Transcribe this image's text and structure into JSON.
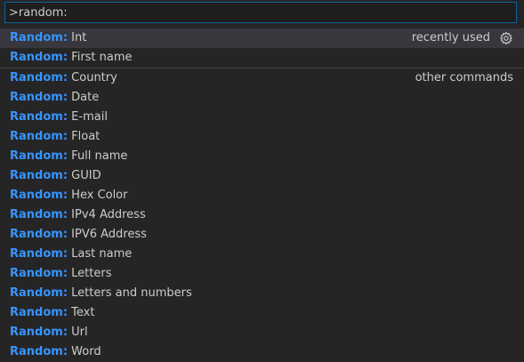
{
  "search": {
    "value": ">random:",
    "placeholder": ""
  },
  "colors": {
    "accent": "#3794ff",
    "focus_border": "#0e639c",
    "selected_bg": "#37373d",
    "panel_bg": "#252526"
  },
  "groups": {
    "recent_label": "recently used",
    "other_label": "other commands",
    "gear_icon": "gear-icon"
  },
  "prefix": "Random:",
  "recent": [
    {
      "name": "Int"
    },
    {
      "name": "First name"
    }
  ],
  "others": [
    {
      "name": "Country"
    },
    {
      "name": "Date"
    },
    {
      "name": "E-mail"
    },
    {
      "name": "Float"
    },
    {
      "name": "Full name"
    },
    {
      "name": "GUID"
    },
    {
      "name": "Hex Color"
    },
    {
      "name": "IPv4 Address"
    },
    {
      "name": "IPV6 Address"
    },
    {
      "name": "Last name"
    },
    {
      "name": "Letters"
    },
    {
      "name": "Letters and numbers"
    },
    {
      "name": "Text"
    },
    {
      "name": "Url"
    },
    {
      "name": "Word"
    }
  ]
}
